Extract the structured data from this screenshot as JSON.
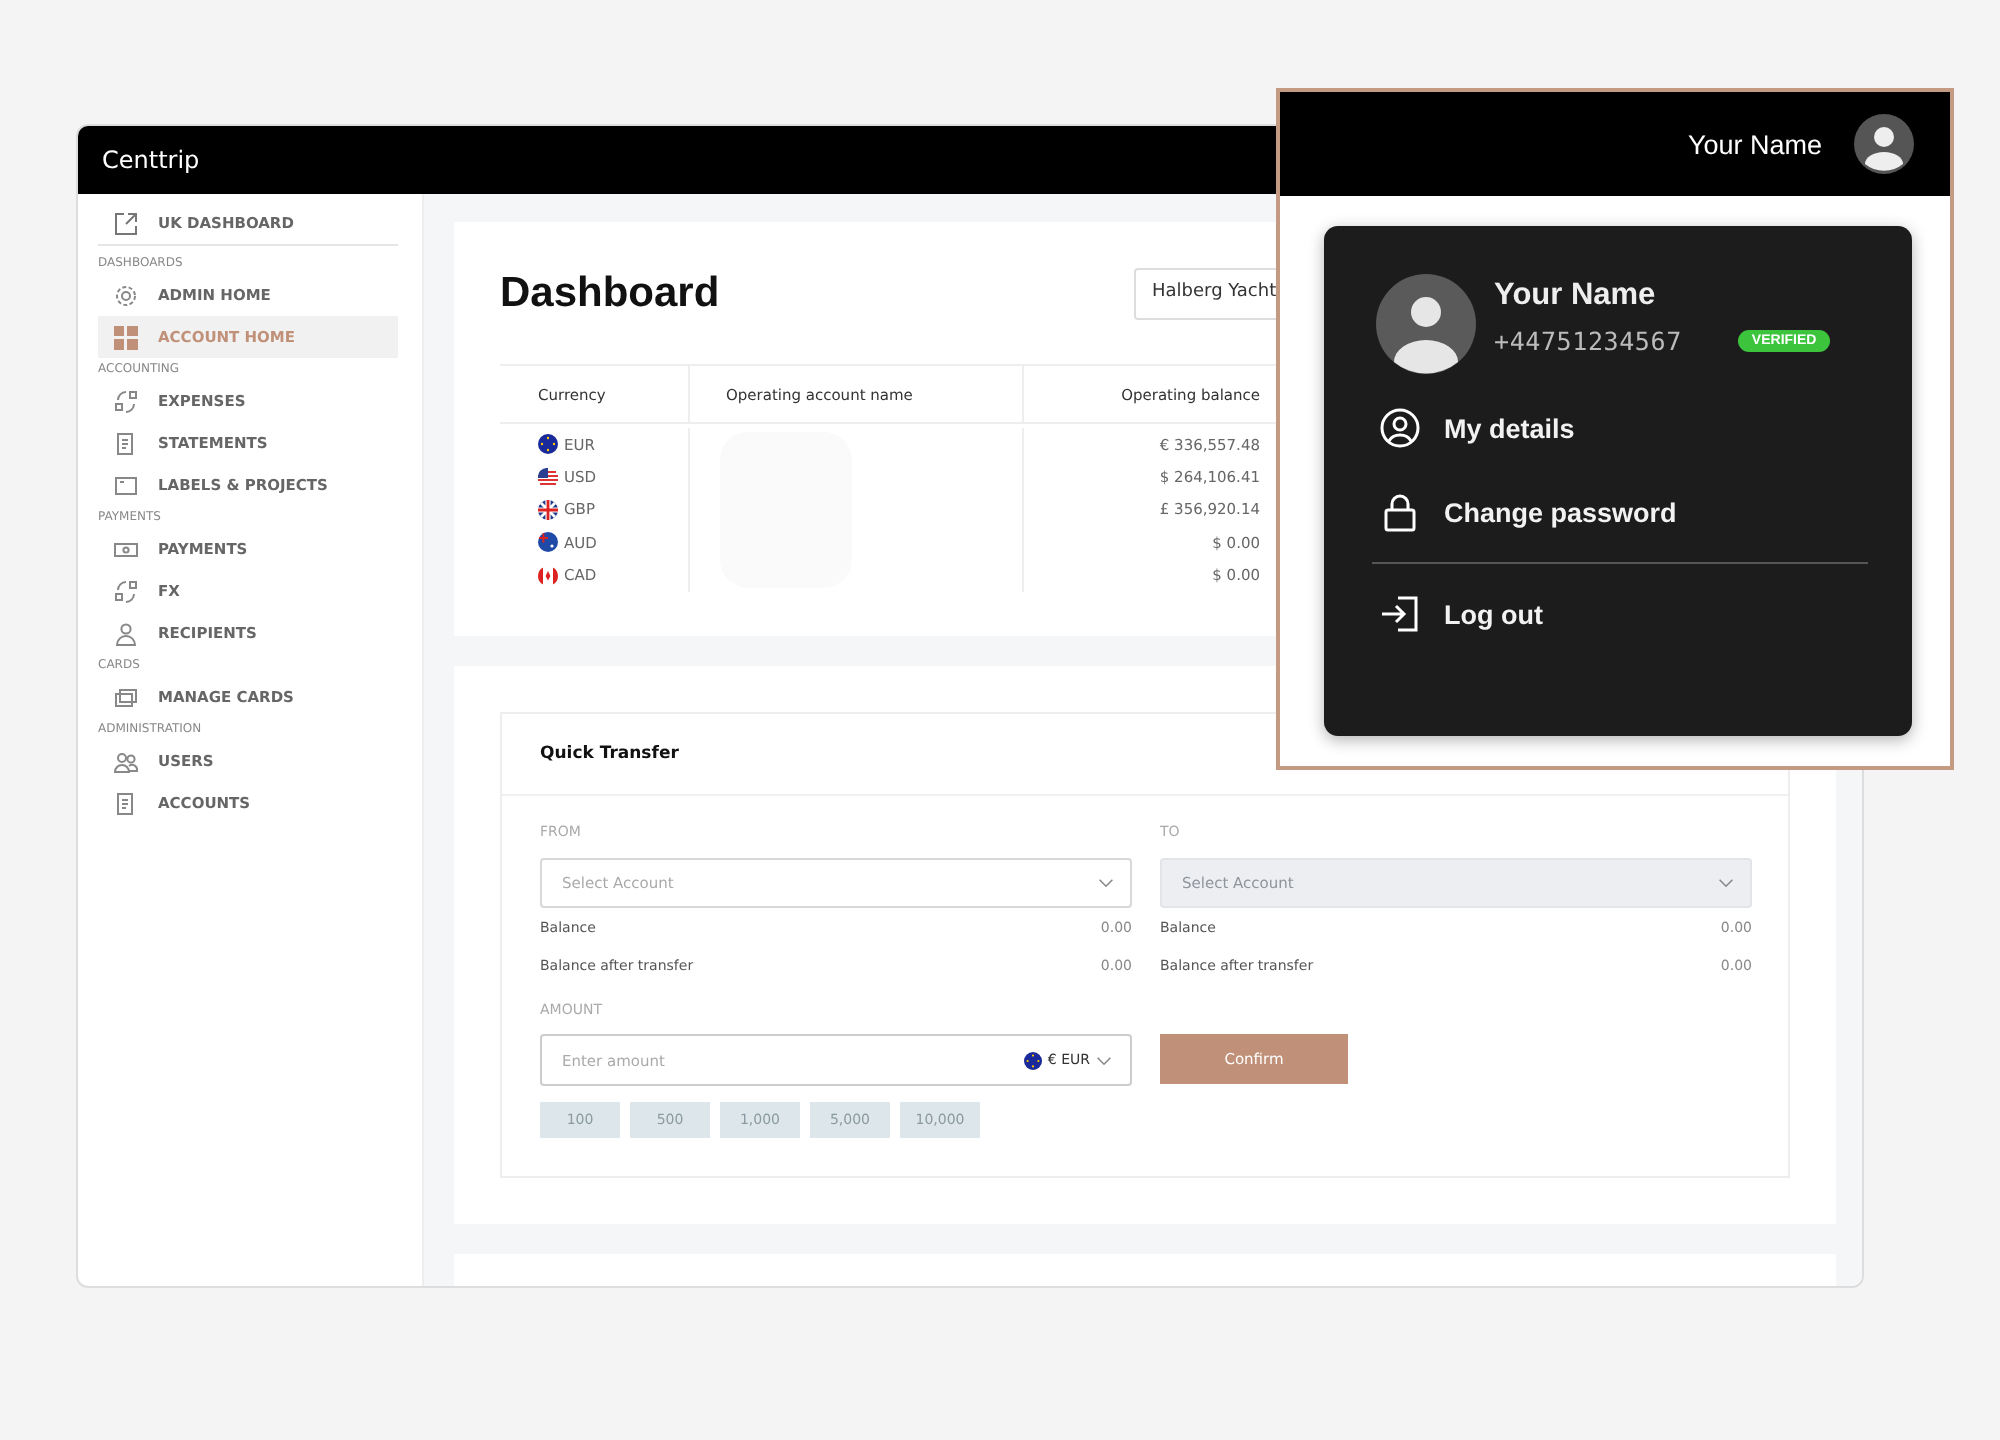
{
  "app": {
    "logo": "Centtrip"
  },
  "sidebar": {
    "top_link": {
      "label": "UK DASHBOARD"
    },
    "sections": [
      {
        "heading": "DASHBOARDS",
        "items": [
          {
            "label": "ADMIN HOME",
            "selected": false
          },
          {
            "label": "ACCOUNT HOME",
            "selected": true
          }
        ]
      },
      {
        "heading": "ACCOUNTING",
        "items": [
          {
            "label": "EXPENSES",
            "selected": false
          },
          {
            "label": "STATEMENTS",
            "selected": false
          },
          {
            "label": "LABELS & PROJECTS",
            "selected": false
          }
        ]
      },
      {
        "heading": "PAYMENTS",
        "items": [
          {
            "label": "PAYMENTS",
            "selected": false
          },
          {
            "label": "FX",
            "selected": false
          },
          {
            "label": "RECIPIENTS",
            "selected": false
          }
        ]
      },
      {
        "heading": "CARDS",
        "items": [
          {
            "label": "MANAGE CARDS",
            "selected": false
          }
        ]
      },
      {
        "heading": "ADMINISTRATION",
        "items": [
          {
            "label": "USERS",
            "selected": false
          },
          {
            "label": "ACCOUNTS",
            "selected": false
          }
        ]
      }
    ]
  },
  "dashboard": {
    "title": "Dashboard",
    "entity_select": {
      "value": "Halberg Yacht"
    },
    "table": {
      "columns": [
        "Currency",
        "Operating account name",
        "Operating balance"
      ],
      "rows": [
        {
          "currency": "EUR",
          "balance": "€ 336,557.48"
        },
        {
          "currency": "USD",
          "balance": "$ 264,106.41"
        },
        {
          "currency": "GBP",
          "balance": "£ 356,920.14"
        },
        {
          "currency": "AUD",
          "balance": "$ 0.00"
        },
        {
          "currency": "CAD",
          "balance": "$ 0.00"
        }
      ]
    }
  },
  "quick_transfer": {
    "title": "Quick Transfer",
    "sides": [
      {
        "label": "FROM",
        "placeholder": "Select Account",
        "disabled": false,
        "balance_label": "Balance",
        "balance": "0.00",
        "after_label": "Balance after transfer",
        "after": "0.00"
      },
      {
        "label": "TO",
        "placeholder": "Select Account",
        "disabled": true,
        "balance_label": "Balance",
        "balance": "0.00",
        "after_label": "Balance after transfer",
        "after": "0.00"
      }
    ],
    "amount": {
      "label": "AMOUNT",
      "placeholder": "Enter amount",
      "currency": "€ EUR"
    },
    "confirm": "Confirm",
    "presets": [
      "100",
      "500",
      "1,000",
      "5,000",
      "10,000"
    ]
  },
  "zoom_callout": {
    "user_name": "Your Name",
    "menu": {
      "name": "Your Name",
      "phone": "+44751234567",
      "badge": "VERIFIED",
      "items": [
        {
          "label": "My details",
          "divider_before": false
        },
        {
          "label": "Change password",
          "divider_before": false
        },
        {
          "label": "Log out",
          "divider_before": true
        }
      ]
    }
  }
}
